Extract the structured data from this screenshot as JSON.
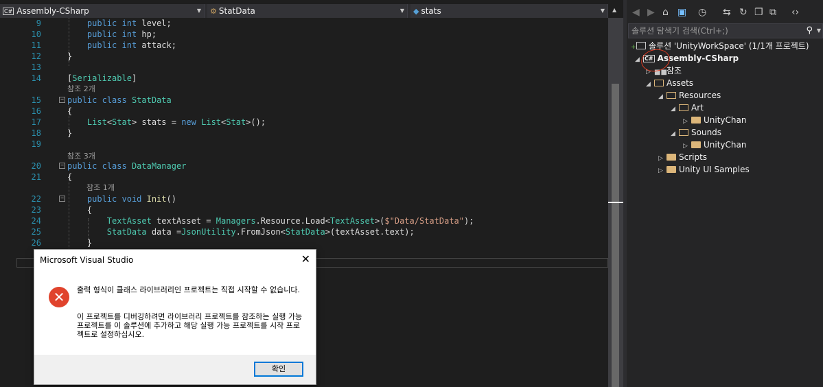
{
  "nav": {
    "project_combo": "Assembly-CSharp",
    "class_combo": "StatData",
    "member_combo": "stats"
  },
  "code_lines": [
    {
      "n": "9",
      "t": "        public int level;"
    },
    {
      "n": "10",
      "t": "        public int hp;"
    },
    {
      "n": "11",
      "t": "        public int attack;"
    },
    {
      "n": "12",
      "t": "    }"
    },
    {
      "n": "13",
      "t": ""
    },
    {
      "n": "14",
      "t": "    [Serializable]"
    },
    {
      "n": "",
      "t": "    참조 2개"
    },
    {
      "n": "15",
      "t": "public class StatData"
    },
    {
      "n": "16",
      "t": "    {"
    },
    {
      "n": "17",
      "t": "        List<Stat> stats = new List<Stat>();"
    },
    {
      "n": "18",
      "t": "    }"
    },
    {
      "n": "19",
      "t": ""
    },
    {
      "n": "",
      "t": "    참조 3개"
    },
    {
      "n": "20",
      "t": "public class DataManager"
    },
    {
      "n": "21",
      "t": "    {"
    },
    {
      "n": "",
      "t": "        참조 1개"
    },
    {
      "n": "22",
      "t": "        public void Init()"
    },
    {
      "n": "23",
      "t": "        {"
    },
    {
      "n": "24",
      "t": "            TextAsset textAsset = Managers.Resource.Load<TextAsset>($\"Data/StatData\");"
    },
    {
      "n": "25",
      "t": "            StatData data =JsonUtility.FromJson<StatData>(textAsset.text);"
    },
    {
      "n": "26",
      "t": "        }"
    }
  ],
  "solution_explorer": {
    "search_placeholder": "솔루션 탐색기 검색(Ctrl+;)",
    "solution_label": "솔루션 'UnityWorkSpace' (1/1개 프로젝트)",
    "project_label": "Assembly-CSharp",
    "nodes": {
      "references": "참조",
      "assets": "Assets",
      "resources": "Resources",
      "art": "Art",
      "unitychan_art": "UnityChan",
      "sounds": "Sounds",
      "unitychan_sounds": "UnityChan",
      "scripts": "Scripts",
      "unity_ui_samples": "Unity UI Samples"
    }
  },
  "dialog": {
    "title": "Microsoft Visual Studio",
    "message_1": "출력 형식이 클래스 라이브러리인 프로젝트는 직접 시작할 수 없습니다.",
    "message_2": "이 프로젝트를 디버깅하려면 라이브러리 프로젝트를 참조하는 실행 가능 프로젝트를 이 솔루션에 추가하고 해당 실행 가능 프로젝트를 시작 프로젝트로 설정하십시오.",
    "ok_label": "확인"
  }
}
